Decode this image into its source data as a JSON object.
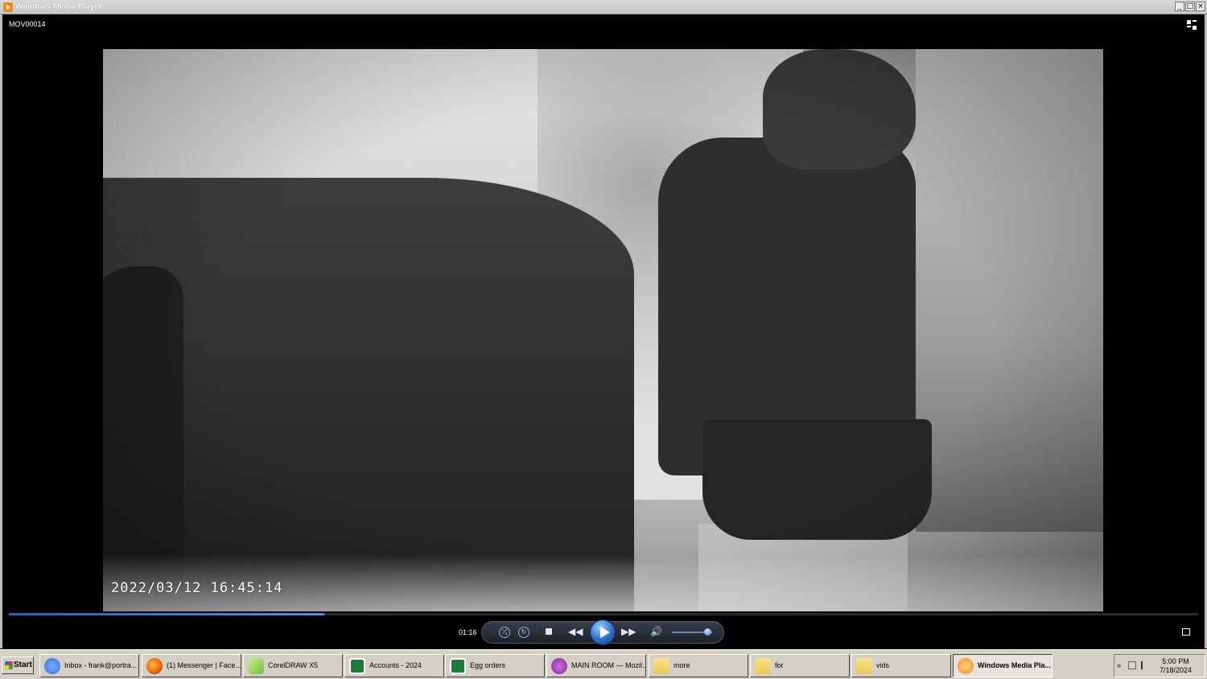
{
  "window": {
    "title": "Windows Media Player",
    "controls": {
      "minimize": "_",
      "maximize": "□",
      "close": "×"
    }
  },
  "player": {
    "file_name": "MOV00014",
    "video_timestamp": "2022/03/12  16:45:14",
    "elapsed_time": "01:16",
    "seek_progress": 0.265,
    "volume_level": 0.9,
    "icons": {
      "switch_view": "switch-to-library-icon",
      "shuffle": "shuffle-icon",
      "repeat": "repeat-icon",
      "stop": "stop-icon",
      "previous": "previous-icon",
      "play": "play-icon",
      "next": "next-icon",
      "mute": "volume-icon",
      "fullscreen": "fullscreen-icon"
    },
    "accent_color": "#2c6fc4"
  },
  "taskbar": {
    "start_label": "Start",
    "tasks": [
      {
        "label": "Inbox - frank@portra...",
        "icon": "thunderbird-icon",
        "color": "#2f6fd6"
      },
      {
        "label": "(1) Messenger | Face...",
        "icon": "firefox-icon",
        "color": "#e66000"
      },
      {
        "label": "CorelDRAW X5",
        "icon": "coreldraw-icon",
        "color": "#7bbf3a"
      },
      {
        "label": "Accounts - 2024",
        "icon": "excel-icon",
        "color": "#1f7a3a"
      },
      {
        "label": "Egg orders",
        "icon": "excel-icon",
        "color": "#1f7a3a"
      },
      {
        "label": "MAIN ROOM — Mozil...",
        "icon": "camera-viewer-icon",
        "color": "#7a2ea0"
      },
      {
        "label": "more",
        "icon": "folder-icon",
        "color": "#e8c85a"
      },
      {
        "label": "for",
        "icon": "folder-icon",
        "color": "#e8c85a"
      },
      {
        "label": "vids",
        "icon": "folder-icon",
        "color": "#e8c85a"
      },
      {
        "label": "Windows Media Pla...",
        "icon": "media-player-icon",
        "color": "#f28c1e",
        "active": true
      }
    ],
    "tray": {
      "time": "5:00 PM",
      "date": "7/18/2024"
    }
  }
}
